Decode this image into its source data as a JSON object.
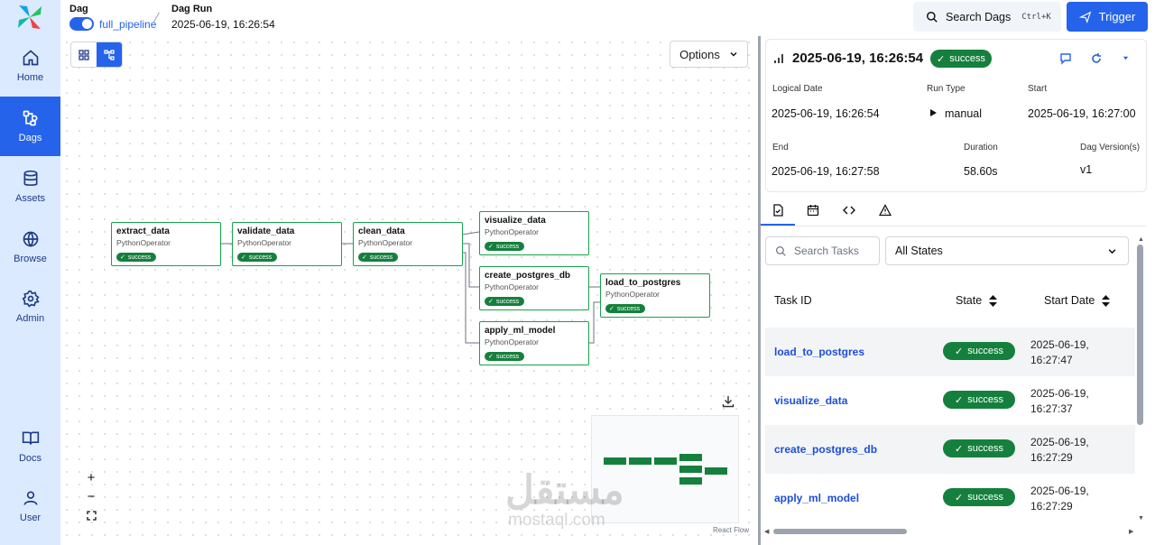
{
  "header": {
    "dag_label": "Dag",
    "dag_name": "full_pipeline",
    "dag_run_label": "Dag Run",
    "dag_run_value": "2025-06-19, 16:26:54",
    "search_label": "Search Dags",
    "search_shortcut": "Ctrl+K",
    "trigger_label": "Trigger"
  },
  "nav": {
    "items": [
      {
        "label": "Home",
        "icon": "home-icon"
      },
      {
        "label": "Dags",
        "icon": "dags-icon",
        "active": true
      },
      {
        "label": "Assets",
        "icon": "database-icon"
      },
      {
        "label": "Browse",
        "icon": "globe-icon"
      },
      {
        "label": "Admin",
        "icon": "gear-icon"
      },
      {
        "label": "Docs",
        "icon": "book-icon"
      },
      {
        "label": "User",
        "icon": "user-icon"
      }
    ]
  },
  "graph": {
    "options_label": "Options",
    "operator": "PythonOperator",
    "status": "success",
    "nodes": [
      {
        "name": "extract_data"
      },
      {
        "name": "validate_data"
      },
      {
        "name": "clean_data"
      },
      {
        "name": "visualize_data"
      },
      {
        "name": "create_postgres_db"
      },
      {
        "name": "load_to_postgres"
      },
      {
        "name": "apply_ml_model"
      }
    ],
    "react_flow_label": "React Flow",
    "watermark_ar": "مستقل",
    "watermark_en": "mostaql.com"
  },
  "run": {
    "title": "2025-06-19, 16:26:54",
    "state": "success",
    "logical_date_label": "Logical Date",
    "logical_date": "2025-06-19, 16:26:54",
    "run_type_label": "Run Type",
    "run_type": "manual",
    "start_label": "Start",
    "start": "2025-06-19, 16:27:00",
    "end_label": "End",
    "end": "2025-06-19, 16:27:58",
    "duration_label": "Duration",
    "duration": "58.60s",
    "version_label": "Dag Version(s)",
    "version": "v1"
  },
  "tasks": {
    "search_placeholder": "Search Tasks",
    "state_filter": "All States",
    "col_task_id": "Task ID",
    "col_state": "State",
    "col_start": "Start Date",
    "rows": [
      {
        "task_id": "load_to_postgres",
        "state": "success",
        "start_date": "2025-06-19, 16:27:47"
      },
      {
        "task_id": "visualize_data",
        "state": "success",
        "start_date": "2025-06-19, 16:27:37"
      },
      {
        "task_id": "create_postgres_db",
        "state": "success",
        "start_date": "2025-06-19, 16:27:29"
      },
      {
        "task_id": "apply_ml_model",
        "state": "success",
        "start_date": "2025-06-19, 16:27:29"
      }
    ]
  },
  "colors": {
    "accent": "#2563eb",
    "success": "#15803d",
    "nav_bg": "#dbeafe"
  }
}
